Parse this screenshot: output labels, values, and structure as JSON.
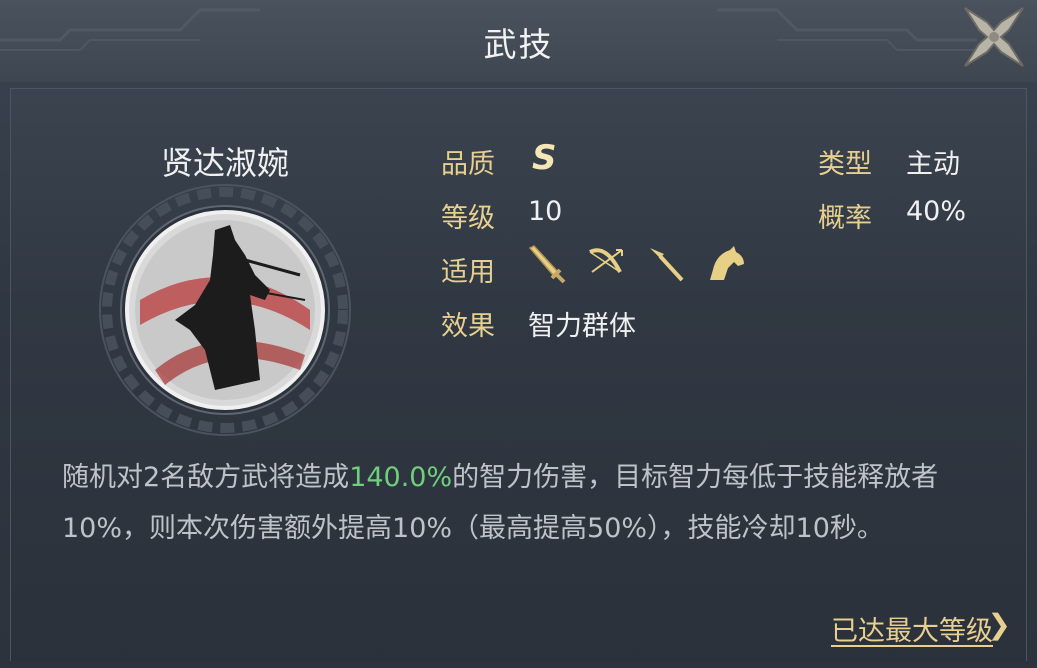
{
  "header": {
    "title": "武技"
  },
  "skill": {
    "name": "贤达淑婉",
    "quality_label": "品质",
    "quality_value": "S",
    "level_label": "等级",
    "level_value": "10",
    "applicable_label": "适用",
    "applicable_icons": [
      "sword-icon",
      "bow-icon",
      "spear-icon",
      "horse-icon"
    ],
    "effect_label": "效果",
    "effect_value": "智力群体",
    "type_label": "类型",
    "type_value": "主动",
    "chance_label": "概率",
    "chance_value": "40%"
  },
  "description": {
    "part1": "随机对2名敌方武将造成",
    "highlight": "140.0%",
    "part2": "的智力伤害，目标智力每低于技能释放者10%，则本次伤害额外提高10%（最高提高50%），技能冷却10秒。"
  },
  "footer": {
    "max_level_link": "已达最大等级",
    "chevron": "❯"
  },
  "colors": {
    "label_gold": "#e6cf8f",
    "highlight_green": "#6fcf7d",
    "text_gray": "#bfc3c8"
  }
}
